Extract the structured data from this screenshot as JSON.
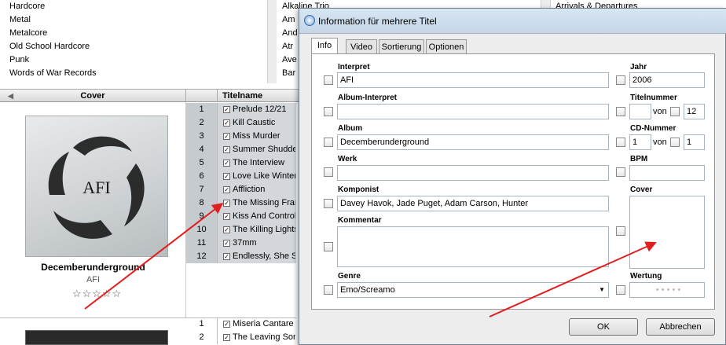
{
  "genres": [
    "Hardcore",
    "Metal",
    "Metalcore",
    "Old School Hardcore",
    "Punk",
    "Words of War Records"
  ],
  "artists": [
    "Alkaline Trio",
    "Am",
    "And",
    "Atr",
    "Ave",
    "Bar"
  ],
  "albums": [
    "Arrivals & Departures"
  ],
  "table": {
    "cover_header": "Cover",
    "title_header": "Titelname"
  },
  "album_card": {
    "title": "Decemberunderground",
    "artist": "AFI",
    "stars": "☆☆☆☆☆"
  },
  "tracks": [
    {
      "num": "1",
      "title": "Prelude 12/21"
    },
    {
      "num": "2",
      "title": "Kill Caustic"
    },
    {
      "num": "3",
      "title": "Miss Murder"
    },
    {
      "num": "4",
      "title": "Summer Shudder"
    },
    {
      "num": "5",
      "title": "The Interview"
    },
    {
      "num": "6",
      "title": "Love Like Winter"
    },
    {
      "num": "7",
      "title": "Affliction"
    },
    {
      "num": "8",
      "title": "The Missing Frame"
    },
    {
      "num": "9",
      "title": "Kiss And Control"
    },
    {
      "num": "10",
      "title": "The Killing Lights"
    },
    {
      "num": "11",
      "title": "37mm"
    },
    {
      "num": "12",
      "title": "Endlessly, She Said"
    }
  ],
  "tracks2": [
    {
      "num": "1",
      "title": "Miseria Cantare"
    },
    {
      "num": "2",
      "title": "The Leaving Song"
    }
  ],
  "dialog": {
    "title": "Information für mehrere Titel",
    "tabs": [
      "Info",
      "Video",
      "Sortierung",
      "Optionen"
    ],
    "labels": {
      "artist": "Interpret",
      "album_artist": "Album-Interpret",
      "album": "Album",
      "work": "Werk",
      "composer": "Komponist",
      "comment": "Kommentar",
      "genre": "Genre",
      "year": "Jahr",
      "track_number": "Titelnummer",
      "disc_number": "CD-Nummer",
      "bpm": "BPM",
      "cover": "Cover",
      "rating": "Wertung",
      "of": "von"
    },
    "values": {
      "artist": "AFI",
      "album_artist": "",
      "album": "Decemberunderground",
      "work": "",
      "composer": "Davey Havok, Jade Puget, Adam Carson, Hunter",
      "comment": "",
      "genre": "Emo/Screamo",
      "year": "2006",
      "track_number": "",
      "track_total": "12",
      "disc_number": "1",
      "disc_total": "1",
      "bpm": "",
      "rating": "• • • • •"
    },
    "ok": "OK",
    "cancel": "Abbrechen"
  },
  "colors": {
    "arrow": "#e02020",
    "selection": "#d3d7db"
  }
}
